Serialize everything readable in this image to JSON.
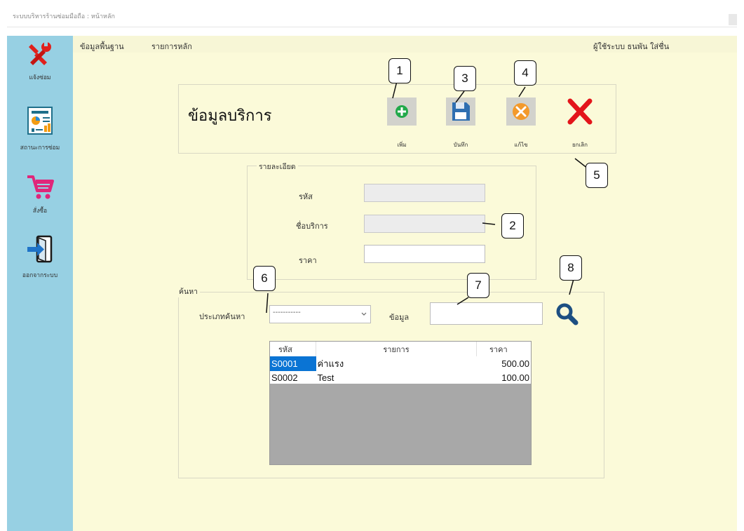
{
  "window": {
    "title": "ระบบบริหารร้านซ่อมมือถือ : หน้าหลัก"
  },
  "sidebar": {
    "items": [
      {
        "label": "แจ้งซ่อม",
        "icon": "repair-tools-icon"
      },
      {
        "label": "สถานะการซ่อม",
        "icon": "report-chart-icon"
      },
      {
        "label": "สั่งซื้อ",
        "icon": "shopping-cart-icon"
      },
      {
        "label": "ออกจากระบบ",
        "icon": "logout-icon"
      }
    ]
  },
  "menubar": {
    "items": [
      "ข้อมูลพื้นฐาน",
      "รายการหลัก"
    ],
    "user": "ผู้ใช้ระบบ ธนพัน ใส่ชื่น"
  },
  "header": {
    "title": "ข้อมูลบริการ",
    "buttons": {
      "add": "เพิ่ม",
      "save": "บันทึก",
      "edit": "แก้ไข",
      "cancel": "ยกเลิก"
    }
  },
  "details": {
    "group_label": "รายละเอียด",
    "code_label": "รหัส",
    "code_value": "",
    "name_label": "ชื่อบริการ",
    "name_value": "",
    "price_label": "ราคา",
    "price_value": ""
  },
  "search": {
    "group_label": "ค้นหา",
    "type_label": "ประเภทค้นหา",
    "type_selected": "-----------",
    "data_label": "ข้อมูล",
    "data_value": ""
  },
  "table": {
    "headers": [
      "รหัส",
      "รายการ",
      "ราคา"
    ],
    "rows": [
      {
        "code": "S0001",
        "name": "ค่าแรง",
        "price": "500.00"
      },
      {
        "code": "S0002",
        "name": "Test",
        "price": "100.00"
      }
    ]
  },
  "callouts": [
    "1",
    "2",
    "3",
    "4",
    "5",
    "6",
    "7",
    "8"
  ],
  "colors": {
    "sidebar": "#97d0e3",
    "background": "#fbfad9",
    "selection": "#0a74d4",
    "grid_empty": "#a8a8a8"
  }
}
